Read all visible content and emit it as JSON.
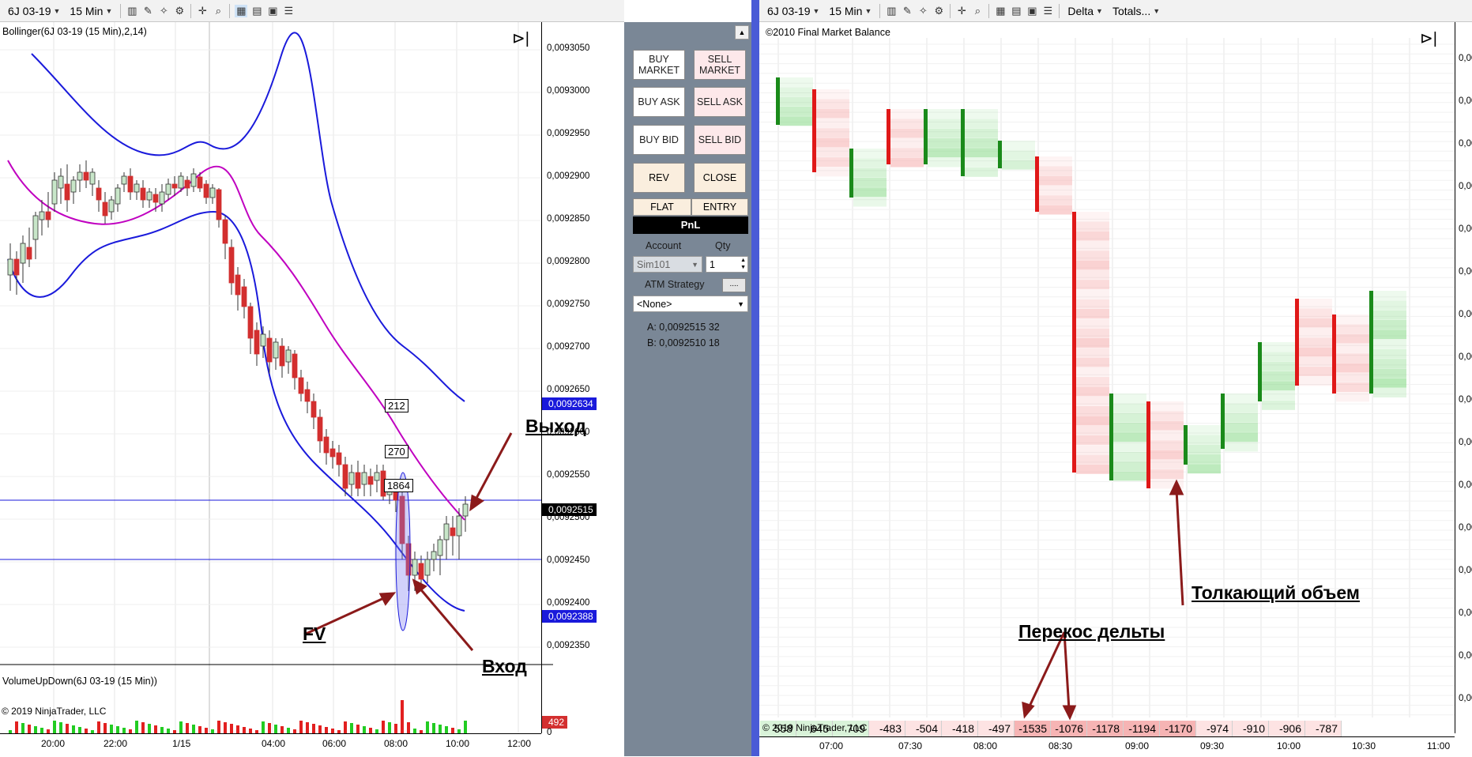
{
  "left_window": {
    "instrument": "6J 03-19",
    "interval": "15 Min",
    "indicator_label": "Bollinger(6J 03-19 (15 Min),2,14)",
    "volume_label": "VolumeUpDown(6J 03-19 (15 Min))",
    "copyright": "© 2019 NinjaTrader, LLC",
    "volume_tag": "492",
    "price_labels": [
      "0,0093050",
      "0,0093000",
      "0,0092950",
      "0,0092900",
      "0,0092850",
      "0,0092800",
      "0,0092750",
      "0,0092700",
      "0,0092650",
      "0,0092600",
      "0,0092550",
      "0,0092500",
      "0,0092450",
      "0,0092400",
      "0,0092350"
    ],
    "price_tags": {
      "upper": "0,0092634",
      "current": "0,0092515",
      "lower": "0,0092388"
    },
    "time_labels": [
      "20:00",
      "22:00",
      "1/15",
      "04:00",
      "06:00",
      "08:00",
      "10:00",
      "12:00"
    ],
    "volume_axis_zero": "0",
    "volume_boxes": [
      "212",
      "270",
      "1864"
    ],
    "annotations": {
      "exit": "Выход",
      "entry": "Вход",
      "fv": "FV"
    }
  },
  "chart_trader": {
    "buttons": {
      "buy_market": "BUY MARKET",
      "sell_market": "SELL MARKET",
      "buy_ask": "BUY ASK",
      "sell_ask": "SELL ASK",
      "buy_bid": "BUY BID",
      "sell_bid": "SELL BID",
      "rev": "REV",
      "close": "CLOSE",
      "flat": "FLAT",
      "entry": "ENTRY"
    },
    "pnl_label": "PnL",
    "account_label": "Account",
    "qty_label": "Qty",
    "account_value": "Sim101",
    "qty_value": "1",
    "atm_label": "ATM Strategy",
    "atm_value": "<None>",
    "ask_line": "A: 0,0092515 32",
    "bid_line": "B: 0,0092510 18"
  },
  "right_window": {
    "instrument": "6J 03-19",
    "interval": "15 Min",
    "delta_dropdown": "Delta",
    "totals_dropdown": "Totals...",
    "title": "©2010 Final Market Balance",
    "price_axis_label": "0,00",
    "price_axis_count": 16,
    "time_labels": [
      "07:00",
      "07:30",
      "08:00",
      "08:30",
      "09:00",
      "09:30",
      "10:00",
      "10:30",
      "11:00"
    ],
    "copyright": "© 2019 NinjaTrader, LLC",
    "delta_totals": [
      "558",
      "645",
      "709",
      "-483",
      "-504",
      "-418",
      "-497",
      "-1535",
      "-1076",
      "-1178",
      "-1194",
      "-1170",
      "-974",
      "-910",
      "-906",
      "-787"
    ],
    "annotations": {
      "delta_skew": "Перекос дельты",
      "pushing_volume": "Толкающий объем"
    }
  },
  "colors": {
    "bull_candle": "#c8e6c9",
    "bear_candle": "#d32f2f",
    "bollinger_band": "#1a1adb",
    "bollinger_mid": "#c000c0",
    "arrow": "#8b1a1a",
    "panel_bg": "#7a8796",
    "positive_cell": "#8fdc8f",
    "negative_cell": "#f6b4b4"
  }
}
